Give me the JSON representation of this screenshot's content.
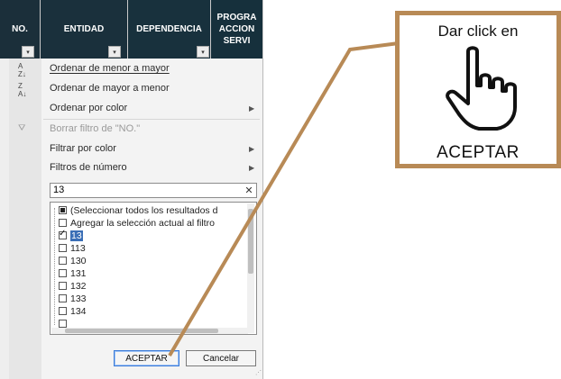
{
  "header": {
    "columns": [
      {
        "label": "NO."
      },
      {
        "label": "ENTIDAD"
      },
      {
        "label": "DEPENDENCIA"
      },
      {
        "label_line1": "PROGRA",
        "label_line2": "ACCION",
        "label_line3": "SERVI"
      }
    ],
    "filter_button_glyph": "▾"
  },
  "menu": {
    "sort_asc": "Ordenar de menor a mayor",
    "sort_desc": "Ordenar de mayor a menor",
    "sort_color": "Ordenar por color",
    "clear_filter": "Borrar filtro de \"NO.\"",
    "filter_color": "Filtrar por color",
    "number_filters": "Filtros de número",
    "icons": {
      "sort_asc": "sort-ascending-icon",
      "sort_desc": "sort-descending-icon",
      "clear_filter": "clear-filter-icon"
    }
  },
  "search": {
    "value": "13",
    "clear_glyph": "✕"
  },
  "list": {
    "items": [
      {
        "label": "(Seleccionar todos los resultados d",
        "state": "indeterminate"
      },
      {
        "label": "Agregar la selección actual al filtro",
        "state": "unchecked"
      },
      {
        "label": "13",
        "state": "checked",
        "highlighted": true
      },
      {
        "label": "113",
        "state": "unchecked"
      },
      {
        "label": "130",
        "state": "unchecked"
      },
      {
        "label": "131",
        "state": "unchecked"
      },
      {
        "label": "132",
        "state": "unchecked"
      },
      {
        "label": "133",
        "state": "unchecked"
      },
      {
        "label": "134",
        "state": "unchecked"
      }
    ]
  },
  "buttons": {
    "ok": "ACEPTAR",
    "cancel": "Cancelar"
  },
  "callout": {
    "top_text": "Dar click en",
    "bottom_text": "ACEPTAR",
    "icon": "pointing-hand-icon",
    "border_color": "#b88a56"
  },
  "colors": {
    "header_bg": "#17303b",
    "accent_line": "#b88a56",
    "selection": "#3b6fb6"
  }
}
